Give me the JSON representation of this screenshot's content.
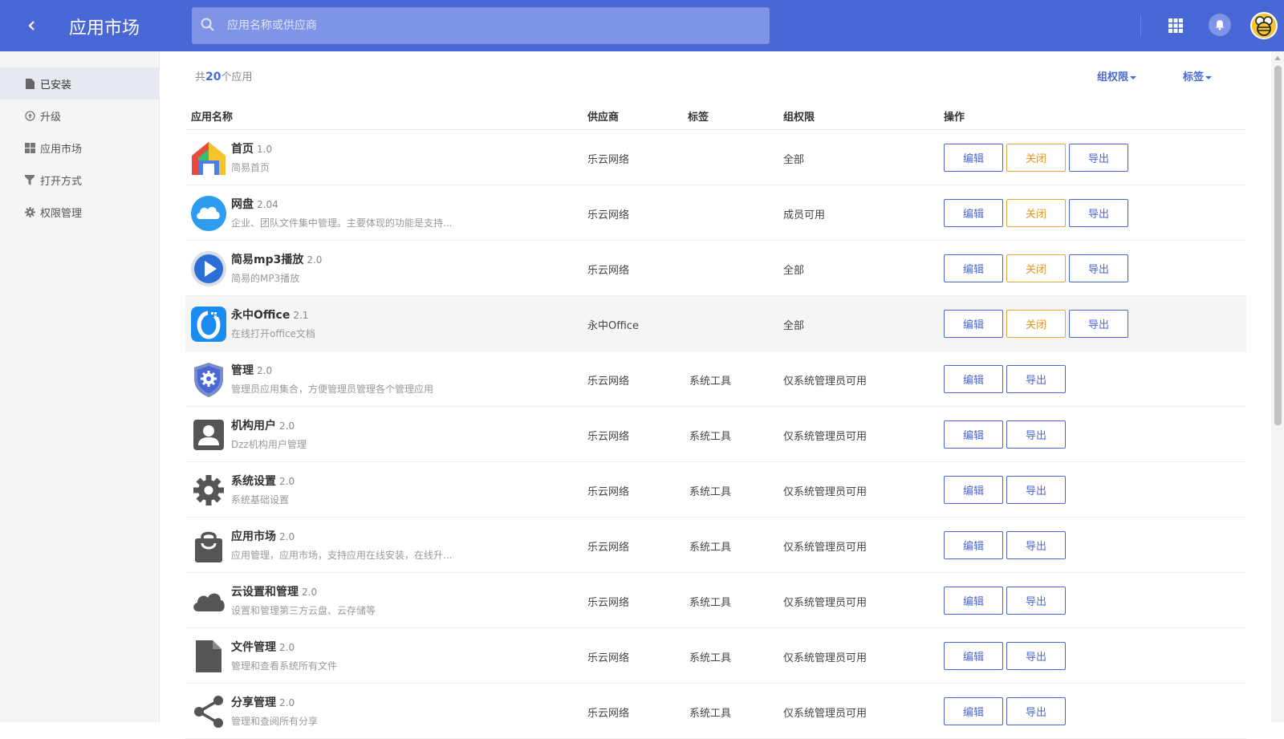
{
  "header": {
    "title": "应用市场",
    "search_placeholder": "应用名称或供应商"
  },
  "sidebar": {
    "items": [
      {
        "label": "已安装",
        "icon": "file-icon"
      },
      {
        "label": "升级",
        "icon": "upgrade-icon"
      },
      {
        "label": "应用市场",
        "icon": "grid-icon"
      },
      {
        "label": "打开方式",
        "icon": "filter-icon"
      },
      {
        "label": "权限管理",
        "icon": "gear-icon"
      }
    ]
  },
  "summary": {
    "prefix": "共",
    "count": "20",
    "suffix": "个应用"
  },
  "filters": {
    "perm": "组权限",
    "tag": "标签"
  },
  "table": {
    "headers": {
      "name": "应用名称",
      "vendor": "供应商",
      "tag": "标签",
      "perm": "组权限",
      "ops": "操作"
    },
    "rows": [
      {
        "name": "首页",
        "version": "1.0",
        "desc": "简易首页",
        "vendor": "乐云网络",
        "tag": "",
        "perm": "全部",
        "icon": "home-icon"
      },
      {
        "name": "网盘",
        "version": "2.04",
        "desc": "企业、团队文件集中管理。主要体现的功能是支持...",
        "vendor": "乐云网络",
        "tag": "",
        "perm": "成员可用",
        "icon": "cloud-drive-icon"
      },
      {
        "name": "简易mp3播放",
        "version": "2.0",
        "desc": "简易的MP3播放",
        "vendor": "乐云网络",
        "tag": "",
        "perm": "全部",
        "icon": "play-icon"
      },
      {
        "name": "永中Office",
        "version": "2.1",
        "desc": "在线打开office文档",
        "vendor": "永中Office",
        "tag": "",
        "perm": "全部",
        "icon": "office-icon"
      },
      {
        "name": "管理",
        "version": "2.0",
        "desc": "管理员应用集合，方便管理员管理各个管理应用",
        "vendor": "乐云网络",
        "tag": "系统工具",
        "perm": "仅系统管理员可用",
        "icon": "shield-gear-icon"
      },
      {
        "name": "机构用户",
        "version": "2.0",
        "desc": "Dzz机构用户管理",
        "vendor": "乐云网络",
        "tag": "系统工具",
        "perm": "仅系统管理员可用",
        "icon": "user-icon"
      },
      {
        "name": "系统设置",
        "version": "2.0",
        "desc": "系统基础设置",
        "vendor": "乐云网络",
        "tag": "系统工具",
        "perm": "仅系统管理员可用",
        "icon": "gear-icon"
      },
      {
        "name": "应用市场",
        "version": "2.0",
        "desc": "应用管理，应用市场，支持应用在线安装，在线升...",
        "vendor": "乐云网络",
        "tag": "系统工具",
        "perm": "仅系统管理员可用",
        "icon": "shopping-bag-icon"
      },
      {
        "name": "云设置和管理",
        "version": "2.0",
        "desc": "设置和管理第三方云盘、云存储等",
        "vendor": "乐云网络",
        "tag": "系统工具",
        "perm": "仅系统管理员可用",
        "icon": "cloud-icon"
      },
      {
        "name": "文件管理",
        "version": "2.0",
        "desc": "管理和查看系统所有文件",
        "vendor": "乐云网络",
        "tag": "系统工具",
        "perm": "仅系统管理员可用",
        "icon": "document-icon"
      },
      {
        "name": "分享管理",
        "version": "2.0",
        "desc": "管理和查阅所有分享",
        "vendor": "乐云网络",
        "tag": "系统工具",
        "perm": "仅系统管理员可用",
        "icon": "share-icon"
      }
    ]
  },
  "buttons": {
    "edit": "编辑",
    "close": "关闭",
    "export": "导出"
  },
  "colors": {
    "header_bg": "#4a67d6",
    "accent": "#4a67d6",
    "warn": "#e0952a"
  }
}
